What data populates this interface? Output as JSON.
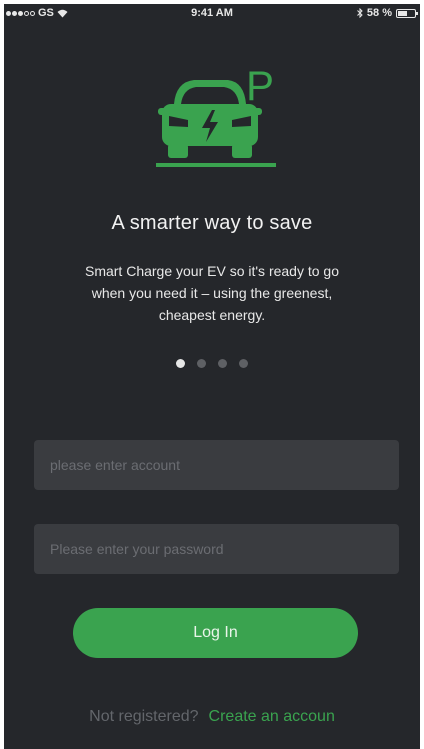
{
  "status_bar": {
    "carrier": "GS",
    "time": "9:41 AM",
    "battery": "58 %",
    "battery_level": 0.58,
    "icons": [
      "signal-dots-icon",
      "wifi-icon",
      "bluetooth-icon",
      "battery-icon"
    ]
  },
  "logo": {
    "icon": "ev-parking-car-icon",
    "letter": "P",
    "color": "#3aa34f"
  },
  "onboarding": {
    "headline": "A smarter way to save",
    "lines": [
      "Smart Charge your EV so it's ready to go",
      "when you need it – using the greenest,",
      "cheapest energy."
    ],
    "page_count": 4,
    "active_page": 1
  },
  "form": {
    "account_placeholder": "please enter account",
    "account_value": "",
    "password_placeholder": "Please enter your password",
    "password_value": "",
    "login_label": "Log In"
  },
  "footer": {
    "prompt": "Not registered?",
    "link": "Create an accoun"
  },
  "colors": {
    "background": "#25272b",
    "accent": "#3aa34f",
    "field": "#3a3c40"
  }
}
